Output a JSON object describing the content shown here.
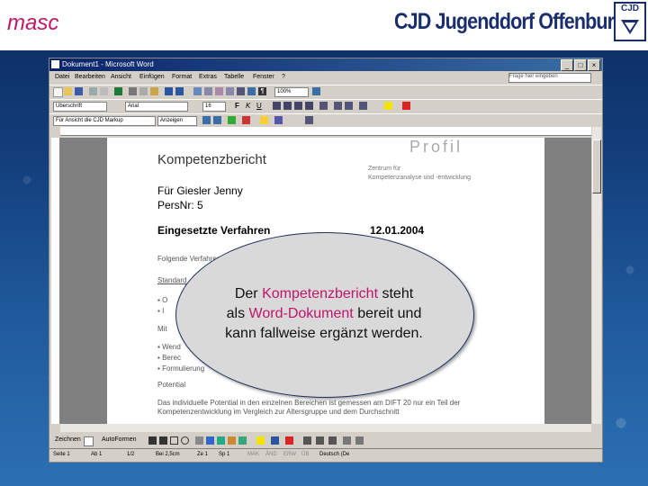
{
  "header": {
    "left_logo": "masc",
    "org_title": "CJD Jugenddorf Offenburg",
    "logo_text": "CJD"
  },
  "word": {
    "window_title": "Dokument1 - Microsoft Word",
    "menu": [
      "Datei",
      "Bearbeiten",
      "Ansicht",
      "Einfügen",
      "Format",
      "Extras",
      "Tabelle",
      "Fenster",
      "?"
    ],
    "help_placeholder": "Frage hier eingeben",
    "zoom": "100%",
    "style_combo": "Überschrift",
    "font_combo": "Arial",
    "size_combo": "16",
    "lang_combo": "Für Ansicht die CJD Markup",
    "display_combo": "Anzeigen",
    "draw_label": "Zeichnen",
    "autoshapes_label": "AutoFormen",
    "status": {
      "page": "Seite 1",
      "section": "Ab 1",
      "pages": "1/2",
      "at": "Bei 2,5cm",
      "line": "Ze 1",
      "col": "Sp 1",
      "modes": [
        "MAK",
        "ÄND",
        "ERW",
        "ÜB"
      ],
      "language": "Deutsch (De"
    }
  },
  "document": {
    "title": "Kompetenzbericht",
    "logo_text": "Profil",
    "zentrum_line1": "Zentrum für",
    "zentrum_line2": "Kompetenzanalyse und -entwicklung",
    "name_line": "Für Giesler Jenny",
    "persnr": "PersNr: 5",
    "verfahren": "Eingesetzte Verfahren",
    "date": "12.01.2004",
    "line_folgende": "Folgende Verfahren",
    "line_standard": "Standard",
    "bullets_a": [
      "O",
      "I"
    ],
    "line_mid": "Mit",
    "bullets_b": [
      "Wend",
      "Berec",
      "Formulierung"
    ],
    "potential_heading": "Potential",
    "body_text": "Das individuelle Potential in den einzelnen Bereichen ist gemessen am DIFT 20 nur ein Teil der Kompetenzentwicklung im Vergleich zur Altersgruppe und dem Durchschnitt"
  },
  "callout": {
    "prefix": "Der",
    "highlight1": "Kompetenzbericht",
    "after1": "steht",
    "prefix2": "als",
    "highlight2": "Word-Dokument",
    "after2": "bereit und",
    "line3": "kann fallweise ergänzt werden."
  }
}
